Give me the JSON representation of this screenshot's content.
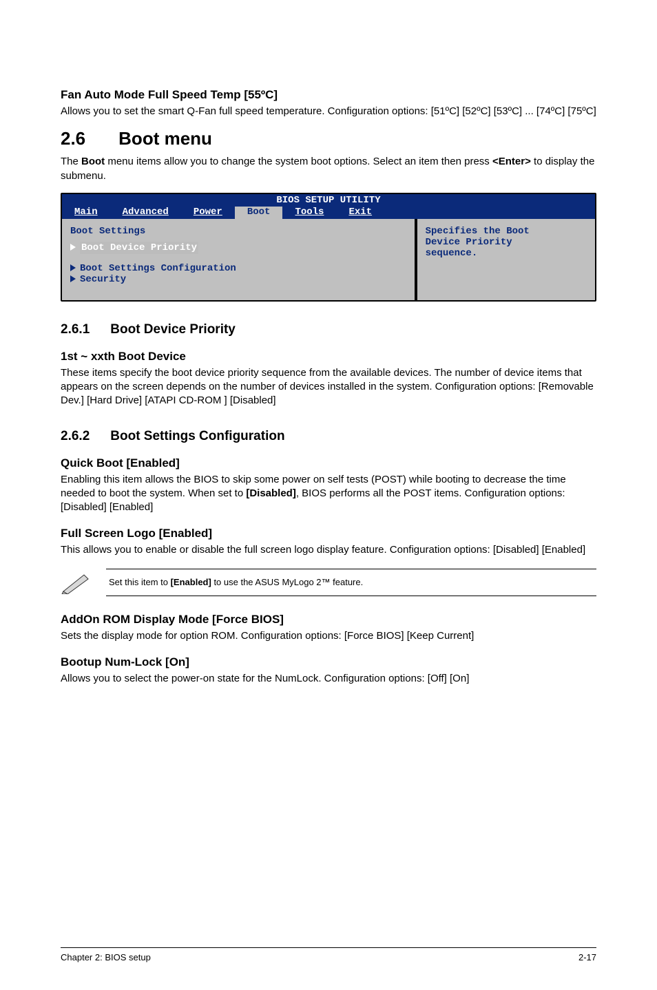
{
  "h_fan": "Fan Auto Mode Full Speed Temp [55ºC]",
  "p_fan": "Allows you to set the smart Q-Fan full speed temperature. Configuration options: [51ºC] [52ºC] [53ºC] ... [74ºC] [75ºC]",
  "sec_num": "2.6",
  "sec_title": "Boot menu",
  "p_boot_intro_a": "The ",
  "p_boot_intro_b": "Boot",
  "p_boot_intro_c": " menu items allow you to change the system boot options. Select an item then press ",
  "p_boot_intro_d": "<Enter>",
  "p_boot_intro_e": " to display the submenu.",
  "bios": {
    "title": "BIOS SETUP UTILITY",
    "tabs": [
      "Main",
      "Advanced",
      "Power",
      "Boot",
      "Tools",
      "Exit"
    ],
    "selected_tab_index": 3,
    "left_heading": "Boot Settings",
    "item_highlight": "Boot Device Priority",
    "sub1": "Boot Settings Configuration",
    "sub2": "Security",
    "right1": "Specifies the Boot",
    "right2": "Device Priority",
    "right3": "sequence."
  },
  "sub1_num": "2.6.1",
  "sub1_title": "Boot Device Priority",
  "h_1st": "1st ~ xxth Boot Device",
  "p_1st": "These items specify the boot device priority sequence from the available devices. The number of device items that appears on the screen depends on the number of devices installed in the system. Configuration options: [Removable Dev.] [Hard Drive] [ATAPI CD-ROM ] [Disabled]",
  "sub2_num": "2.6.2",
  "sub2_title": "Boot Settings Configuration",
  "h_qb": "Quick Boot [Enabled]",
  "p_qb_a": "Enabling this item allows the BIOS to skip some power on self tests (POST) while booting to decrease the time needed to boot the system. When set to ",
  "p_qb_b": "[Disabled]",
  "p_qb_c": ", BIOS performs all the POST items. Configuration options: [Disabled] [Enabled]",
  "h_fsl": "Full Screen Logo [Enabled]",
  "p_fsl": "This allows you to enable or disable the full screen logo display feature. Configuration options: [Disabled] [Enabled]",
  "note_a": "Set this item to ",
  "note_b": "[Enabled]",
  "note_c": " to use the ASUS MyLogo 2™ feature.",
  "h_addon": "AddOn ROM Display Mode [Force BIOS]",
  "p_addon": "Sets the display mode for option ROM. Configuration options: [Force BIOS] [Keep Current]",
  "h_num": "Bootup Num-Lock [On]",
  "p_num": "Allows you to select the power-on state for the NumLock. Configuration options: [Off] [On]",
  "footer_left": "Chapter 2: BIOS setup",
  "footer_right": "2-17"
}
